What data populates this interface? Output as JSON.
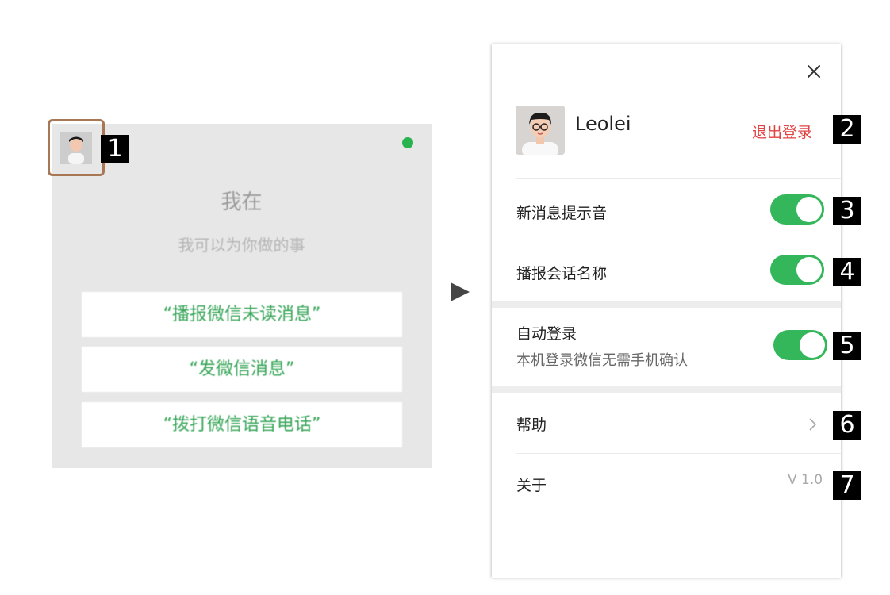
{
  "assistant": {
    "title": "我在",
    "subtitle": "我可以为你做的事",
    "commands": [
      "“播报微信未读消息”",
      "“发微信消息”",
      "“拨打微信语音电话”"
    ],
    "status_color": "#29b34f"
  },
  "markers": [
    "1",
    "2",
    "3",
    "4",
    "5",
    "6",
    "7"
  ],
  "settings": {
    "user_name": "Leolei",
    "logout_label": "退出登录",
    "items": [
      {
        "label": "新消息提示音",
        "toggle": true
      },
      {
        "label": "播报会话名称",
        "toggle": true
      },
      {
        "label": "自动登录",
        "subtitle": "本机登录微信无需手机确认",
        "toggle": true
      }
    ],
    "help_label": "帮助",
    "about_label": "关于",
    "version": "V 1.0",
    "accent_color": "#34b75a",
    "logout_color": "#e04343"
  },
  "icons": [
    "avatar-icon",
    "close-icon",
    "chevron-right-icon",
    "arrow-right-icon"
  ]
}
